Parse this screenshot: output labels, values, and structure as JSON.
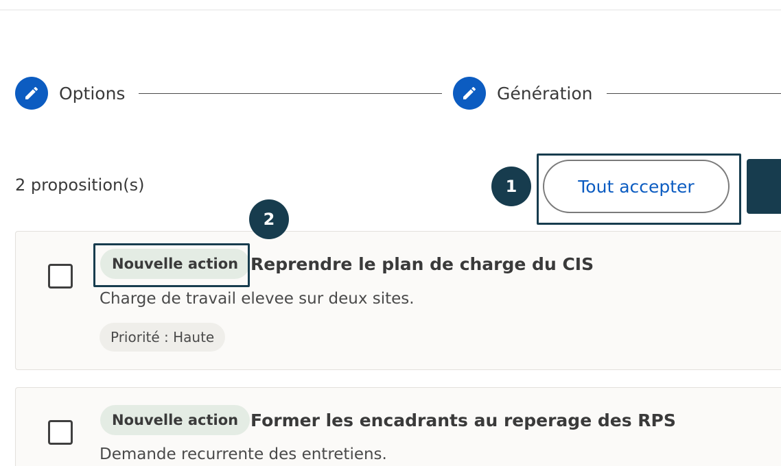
{
  "stepper": {
    "steps": [
      {
        "label": "Options",
        "icon": "pencil-icon"
      },
      {
        "label": "Génération",
        "icon": "pencil-icon"
      }
    ]
  },
  "toolbar": {
    "count_text": "2 proposition(s)",
    "accept_all_label": "Tout accepter"
  },
  "annotations": {
    "marker_1": "1",
    "marker_2": "2"
  },
  "proposals": [
    {
      "tag": "Nouvelle action",
      "title": "Reprendre le plan de charge du CIS",
      "description": "Charge de travail elevee sur deux sites.",
      "priority": "Priorité : Haute",
      "checked": false
    },
    {
      "tag": "Nouvelle action",
      "title": "Former les encadrants au reperage des RPS",
      "description": "Demande recurrente des entretiens.",
      "checked": false
    }
  ],
  "colors": {
    "accent": "#0c5cc1",
    "dark": "#173c4e",
    "tag_bg": "#e4ece4",
    "card_bg": "#fbfaf8"
  }
}
